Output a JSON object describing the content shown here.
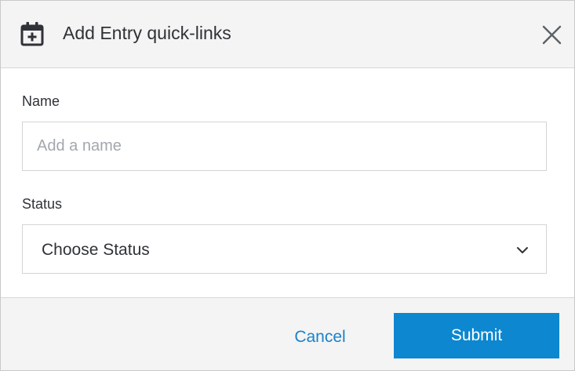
{
  "dialog": {
    "title": "Add Entry quick-links",
    "header_icon": "calendar-plus-icon",
    "close_icon": "close-icon"
  },
  "form": {
    "name": {
      "label": "Name",
      "placeholder": "Add a name",
      "value": ""
    },
    "status": {
      "label": "Status",
      "selected": "Choose Status",
      "icon": "chevron-down-icon"
    }
  },
  "footer": {
    "cancel_label": "Cancel",
    "submit_label": "Submit"
  },
  "colors": {
    "accent": "#0d87cf",
    "link": "#1b82c8",
    "header_bg": "#f4f4f4",
    "text": "#2f3237"
  }
}
